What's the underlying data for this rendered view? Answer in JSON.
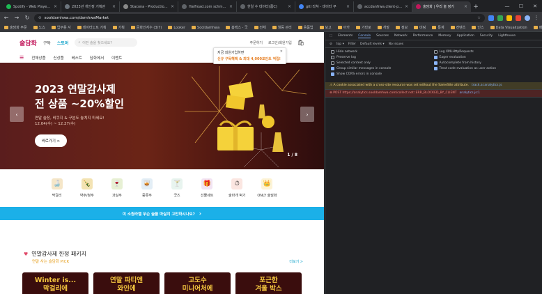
{
  "browser": {
    "tabs": [
      {
        "label": "Spotify - Web Player: M",
        "color": "#1db954",
        "active": false
      },
      {
        "label": "2023년 개인정 기획관",
        "color": "#6c757d",
        "active": false
      },
      {
        "label": "Stacona - Production II",
        "color": "#888888",
        "active": false
      },
      {
        "label": "Halfroad.com schmea.io",
        "color": "#5f6368",
        "active": false
      },
      {
        "label": "한일 수 데이터(롬C)",
        "color": "#5f6368",
        "active": false
      },
      {
        "label": "gitl 라쳐 - 데이터 부",
        "color": "#4285f4",
        "active": false
      },
      {
        "label": "accdanfrwa.client-prod",
        "color": "#5f6368",
        "active": false
      },
      {
        "label": "술담화 | 우리 술 정기",
        "color": "#c2185b",
        "active": true
      }
    ],
    "url": "sooldamhwa.com/damhwaMarket",
    "bookmarks": [
      "술담화 주문",
      "노쇼",
      "업무용 서",
      "데이터노트 기획",
      "기획",
      "문화인지수 (3/7)",
      "Looker",
      "Sooldamhwa",
      "홈택스 - 국",
      "전체",
      "월등 관리",
      "용품업",
      "보고",
      "아카",
      "기타로",
      "개발",
      "정보",
      "미팅",
      "통계",
      "컨텐츠",
      "인스",
      "Data Visualization",
      "매일",
      "워크",
      "아웃"
    ]
  },
  "site": {
    "logo": "술담화",
    "header_links": [
      {
        "label": "구독",
        "active": false
      },
      {
        "label": "스토어",
        "active": true
      }
    ],
    "search_placeholder": "어떤 술을 찾으세요?",
    "header_right": [
      "주문하기",
      "로그인/회원가입"
    ],
    "popup": {
      "line1": "지금 회원가입하면",
      "line2": "신규 구독혜택 & 최대 4,000포인트 적립!",
      "close": "×"
    },
    "nav": [
      "전체상품",
      "신상품",
      "베스트",
      "담화에서",
      "이벤트"
    ],
    "banner": {
      "title_line1": "2023 연말감사제",
      "title_line2": "전 상품 ~20%할인",
      "sub_line1": "연말 술장, 비쿠지 & 구분도 놓치지 마세요!",
      "sub_line2": "12.04(수) ~ 12.27(수)",
      "button": "바로가기 >",
      "counter": "1 / 8",
      "prev": "‹",
      "next": "›"
    },
    "categories": [
      {
        "label": "막걸리",
        "icon": "🍶",
        "color": "#f5e6c8"
      },
      {
        "label": "약주/청주",
        "icon": "🍾",
        "color": "#f3e3b3"
      },
      {
        "label": "과실주",
        "icon": "🍷",
        "color": "#e7f0d4"
      },
      {
        "label": "증류주",
        "icon": "🥃",
        "color": "#e3eef6"
      },
      {
        "label": "굿즈",
        "icon": "🍸",
        "color": "#e8f4ef"
      },
      {
        "label": "선물세트",
        "icon": "🎁",
        "color": "#f2e4f3"
      },
      {
        "label": "술마개 벅기",
        "icon": "⏱",
        "color": "#fbe6e1"
      },
      {
        "label": "ONLY 술담화",
        "icon": "👑",
        "color": "#fdf3d6"
      }
    ],
    "strip_text": "이 소원라벨 무슨 술을 마실지 고민하시나요?",
    "strip_arrow": "›",
    "section": {
      "title": "연말감사제 한정 패키지",
      "subtitle": "연말 사는 술담화 PICK",
      "more": "더보기 >",
      "cards": [
        {
          "line1": "Winter is...",
          "line2": "막걸리에"
        },
        {
          "line1": "연말 파티엔",
          "line2": "와인에"
        },
        {
          "line1": "고도수",
          "line2": "미니어처에"
        },
        {
          "line1": "포근한",
          "line2": "겨울 박스"
        }
      ]
    }
  },
  "devtools": {
    "tabs": [
      "Elements",
      "Console",
      "Sources",
      "Network",
      "Performance",
      "Memory",
      "Application",
      "Security",
      "Lighthouse"
    ],
    "active_tab": "Console",
    "bar": [
      "top ▾",
      "Filter",
      "Default levels ▾",
      "No issues"
    ],
    "options": [
      {
        "label": "Hide network",
        "checked": false
      },
      {
        "label": "Log XMLHttpRequests",
        "checked": false
      },
      {
        "label": "Preserve log",
        "checked": false
      },
      {
        "label": "Eager evaluation",
        "checked": true
      },
      {
        "label": "Selected context only",
        "checked": false
      },
      {
        "label": "Autocomplete from history",
        "checked": true
      },
      {
        "label": "Group similar messages in console",
        "checked": true
      },
      {
        "label": "Treat code evaluation as user action",
        "checked": true
      },
      {
        "label": "Show CORS errors in console",
        "checked": true
      },
      {
        "label": "",
        "checked": false
      }
    ],
    "messages": [
      {
        "type": "warn",
        "text": "A cookie associated with a cross-site resource was set without the SameSite attribute.",
        "source": "track.ai.analytics.js"
      },
      {
        "type": "err",
        "text": "POST https://analytics.sooldamhwa.com/collect net::ERR_BLOCKED_BY_CLIENT",
        "source": "analytics.js:1"
      }
    ]
  }
}
